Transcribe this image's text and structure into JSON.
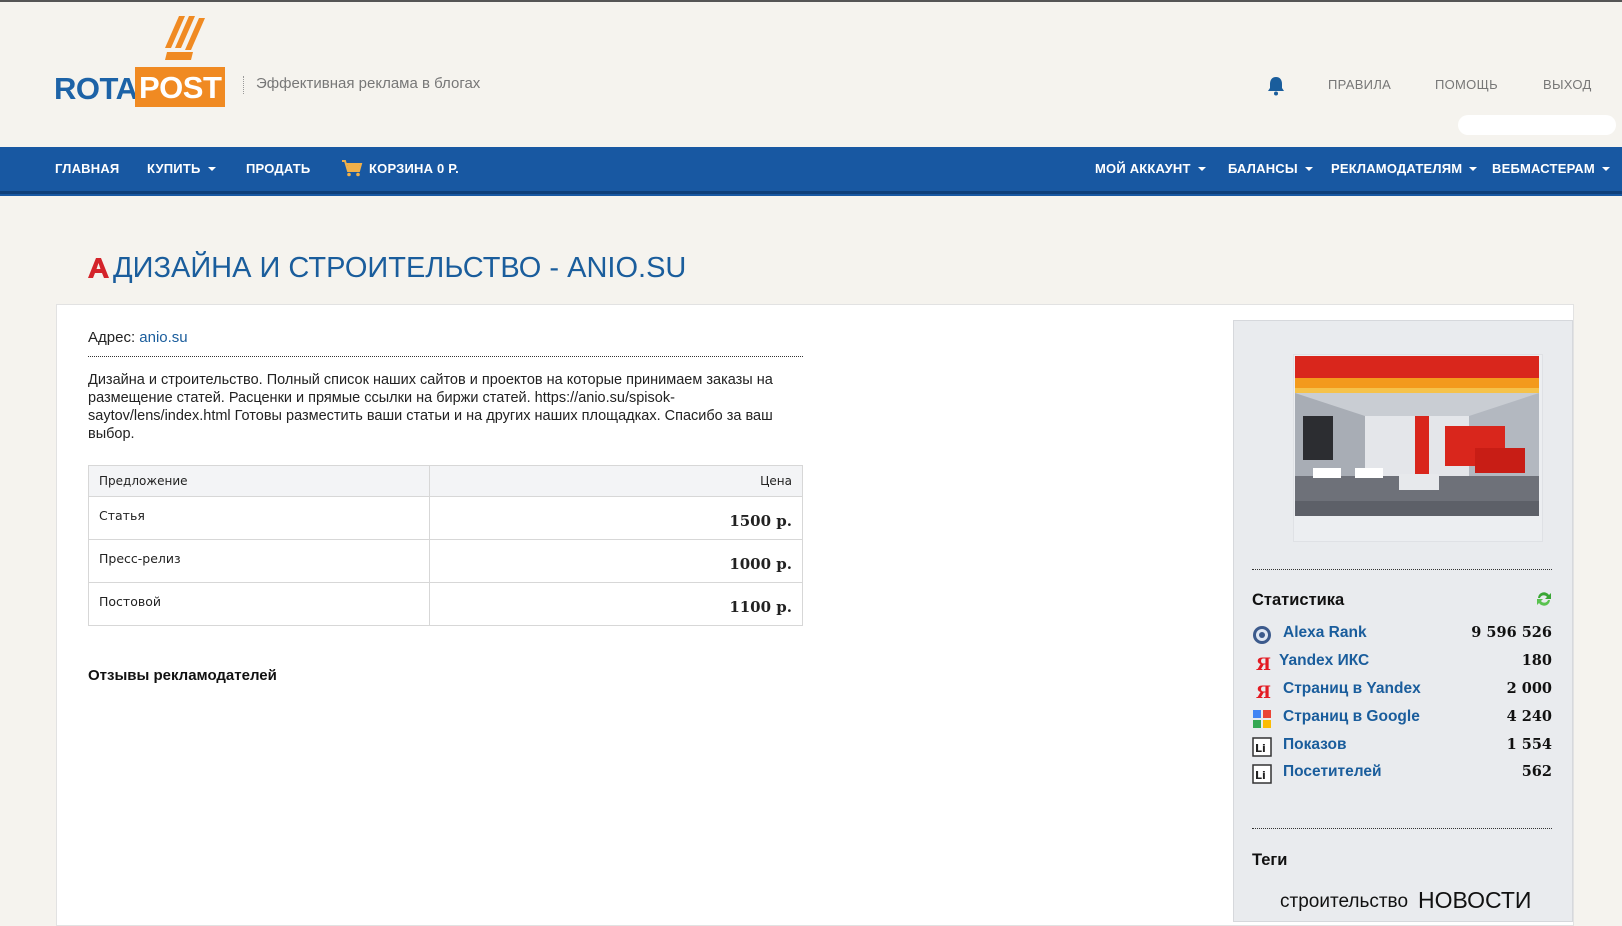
{
  "header": {
    "logo_part1": "ROTA",
    "logo_part2": "POST",
    "tagline": "Эффективная реклама в блогах",
    "links": [
      "ПРАВИЛА",
      "ПОМОЩЬ",
      "ВЫХОД"
    ]
  },
  "nav": {
    "home": "ГЛАВНАЯ",
    "buy": "КУПИТЬ",
    "sell": "ПРОДАТЬ",
    "cart": "КОРЗИНА 0 Р.",
    "account": "МОЙ АККАУНТ",
    "balances": "БАЛАНСЫ",
    "advertisers": "РЕКЛАМОДАТЕЛЯМ",
    "webmasters": "ВЕБМАСТЕРАМ"
  },
  "page": {
    "title": "ДИЗАЙНА И СТРОИТЕЛЬСТВО - ANIO.SU",
    "address_label": "Адрес:",
    "address_value": "anio.su",
    "description": "Дизайна и строительство. Полный список наших сайтов и проектов на которые принимаем заказы на размещение статей. Расценки и прямые ссылки на биржи статей. https://anio.su/spisok-saytov/lens/index.html Готовы разместить ваши статьи и на других наших площадках. Спасибо за ваш выбор.",
    "reviews_title": "Отзывы рекламодателей"
  },
  "offers": {
    "header_offer": "Предложение",
    "header_price": "Цена",
    "rows": [
      {
        "name": "Статья",
        "price": "1500 р."
      },
      {
        "name": "Пресс-релиз",
        "price": "1000 р."
      },
      {
        "name": "Постовой",
        "price": "1100 р."
      }
    ]
  },
  "stats": {
    "title": "Статистика",
    "rows": [
      {
        "label": "Alexa Rank",
        "value": "9 596 526",
        "icon": "alexa-icon"
      },
      {
        "label": "Yandex ИКС",
        "value": "180",
        "icon": "yandex-icon"
      },
      {
        "label": "Страниц в Yandex",
        "value": "2 000",
        "icon": "yandex-icon"
      },
      {
        "label": "Страниц в Google",
        "value": "4 240",
        "icon": "google-icon"
      },
      {
        "label": "Показов",
        "value": "1 554",
        "icon": "liveinternet-icon"
      },
      {
        "label": "Посетителей",
        "value": "562",
        "icon": "liveinternet-icon"
      }
    ]
  },
  "tags": {
    "title": "Теги",
    "items": [
      "строительство",
      "НОВОСТИ"
    ]
  },
  "colors": {
    "brand_blue": "#1858a2",
    "brand_orange": "#f08a22",
    "link_blue": "#1a5d9c",
    "background": "#f5f3ee"
  }
}
